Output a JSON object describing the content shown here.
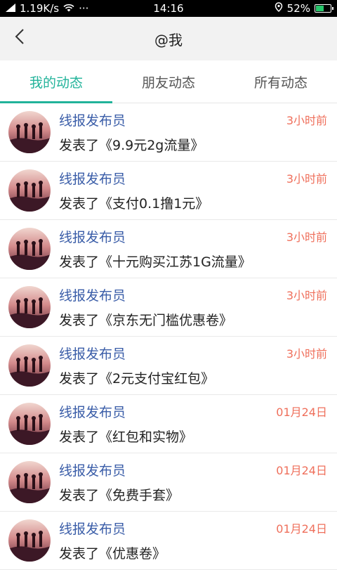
{
  "status_bar": {
    "speed": "1.19K/s",
    "more": "···",
    "time": "14:16",
    "battery": "52%",
    "battery_level": 0.52,
    "battery_color": "#27c66b"
  },
  "header": {
    "title": "@我"
  },
  "tabs": [
    {
      "label": "我的动态",
      "active": true
    },
    {
      "label": "朋友动态",
      "active": false
    },
    {
      "label": "所有动态",
      "active": false
    }
  ],
  "accent_color": "#22b39a",
  "feed": [
    {
      "author": "线报发布员",
      "action": "发表了《9.9元2g流量》",
      "time": "3小时前"
    },
    {
      "author": "线报发布员",
      "action": "发表了《支付0.1撸1元》",
      "time": "3小时前"
    },
    {
      "author": "线报发布员",
      "action": "发表了《十元购买江苏1G流量》",
      "time": "3小时前"
    },
    {
      "author": "线报发布员",
      "action": "发表了《京东无门槛优惠卷》",
      "time": "3小时前"
    },
    {
      "author": "线报发布员",
      "action": "发表了《2元支付宝红包》",
      "time": "3小时前"
    },
    {
      "author": "线报发布员",
      "action": "发表了《红包和实物》",
      "time": "01月24日"
    },
    {
      "author": "线报发布员",
      "action": "发表了《免费手套》",
      "time": "01月24日"
    },
    {
      "author": "线报发布员",
      "action": "发表了《优惠卷》",
      "time": "01月24日"
    }
  ]
}
